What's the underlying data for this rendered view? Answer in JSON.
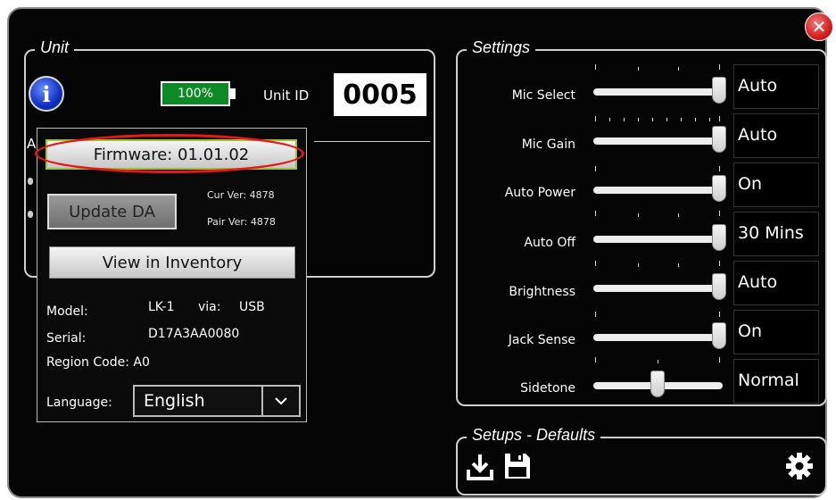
{
  "window": {
    "close_icon": "close-icon"
  },
  "unit": {
    "title": "Unit",
    "battery": "100%",
    "unit_id_label": "Unit ID",
    "unit_id": "0005",
    "peek_letter": "A"
  },
  "popup": {
    "firmware": "Firmware: 01.01.02",
    "update": "Update DA",
    "cur_ver": "Cur Ver: 4878",
    "pair_ver": "Pair Ver: 4878",
    "inventory": "View in Inventory",
    "model_label": "Model:",
    "model_value": "LK-1",
    "via_label": "via:",
    "via_value": "USB",
    "serial_label": "Serial:",
    "serial_value": "D17A3AA0080",
    "region": "Region Code: A0",
    "language_label": "Language:",
    "language_value": "English"
  },
  "settings": {
    "title": "Settings",
    "rows": [
      {
        "label": "Mic Select",
        "value": "Auto",
        "level": 1.0
      },
      {
        "label": "Mic Gain",
        "value": "Auto",
        "level": 1.0
      },
      {
        "label": "Auto Power",
        "value": "On",
        "level": 1.0
      },
      {
        "label": "Auto Off",
        "value": "30 Mins",
        "level": 1.0
      },
      {
        "label": "Brightness",
        "value": "Auto",
        "level": 1.0
      },
      {
        "label": "Jack Sense",
        "value": "On",
        "level": 1.0
      },
      {
        "label": "Sidetone",
        "value": "Normal",
        "level": 0.5
      }
    ]
  },
  "setups": {
    "title": "Setups - Defaults",
    "icons": [
      "download-icon",
      "save-icon",
      "gear-icon"
    ]
  }
}
